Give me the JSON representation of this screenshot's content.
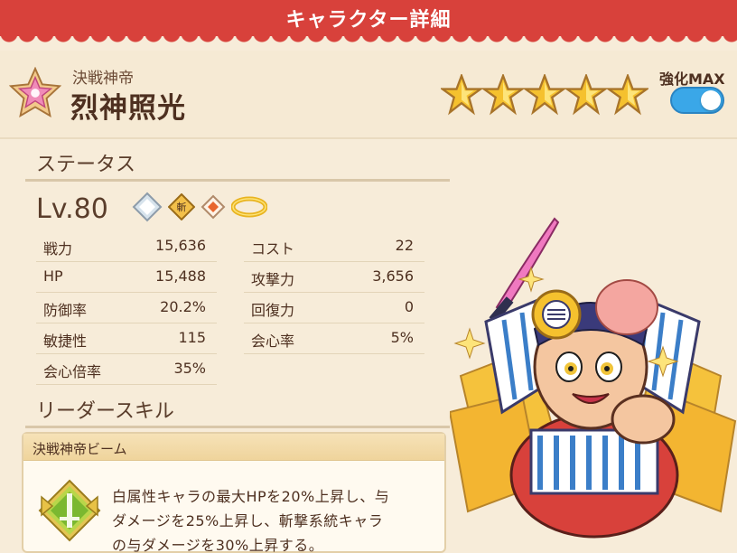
{
  "header": {
    "title": "キャラクター詳細"
  },
  "character": {
    "subtitle": "決戦神帝",
    "name": "烈神照光",
    "rarity_stars": 5,
    "level_label": "Lv.80",
    "attribute_icon": "pink-star-badge-icon"
  },
  "toggle": {
    "label": "強化MAX",
    "enabled": true
  },
  "status": {
    "title": "ステータス",
    "left": [
      {
        "label": "戦力",
        "value": "15,636"
      },
      {
        "label": "HP",
        "value": "15,488"
      },
      {
        "label": "防御率",
        "value": "20.2%"
      },
      {
        "label": "敏捷性",
        "value": "115"
      },
      {
        "label": "会心倍率",
        "value": "35%"
      }
    ],
    "right": [
      {
        "label": "コスト",
        "value": "22"
      },
      {
        "label": "攻撃力",
        "value": "3,656"
      },
      {
        "label": "回復力",
        "value": "0"
      },
      {
        "label": "会心率",
        "value": "5%"
      }
    ],
    "icons": [
      "white-diamond-icon",
      "slash-badge-icon",
      "orange-diamond-icon",
      "gold-ring-icon"
    ],
    "slash_text": "斬"
  },
  "leader_skill": {
    "title": "リーダースキル",
    "name": "決戦神帝ビーム",
    "description_lines": [
      "白属性キャラの最大HPを20%上昇し、与",
      "ダメージを25%上昇し、斬撃系統キャラ",
      "の与ダメージを30%上昇する。"
    ]
  },
  "colors": {
    "header_red": "#d8413b",
    "background": "#f7ecd9",
    "toggle_blue": "#3aa7e8",
    "star_gold": "#f5c12e"
  }
}
